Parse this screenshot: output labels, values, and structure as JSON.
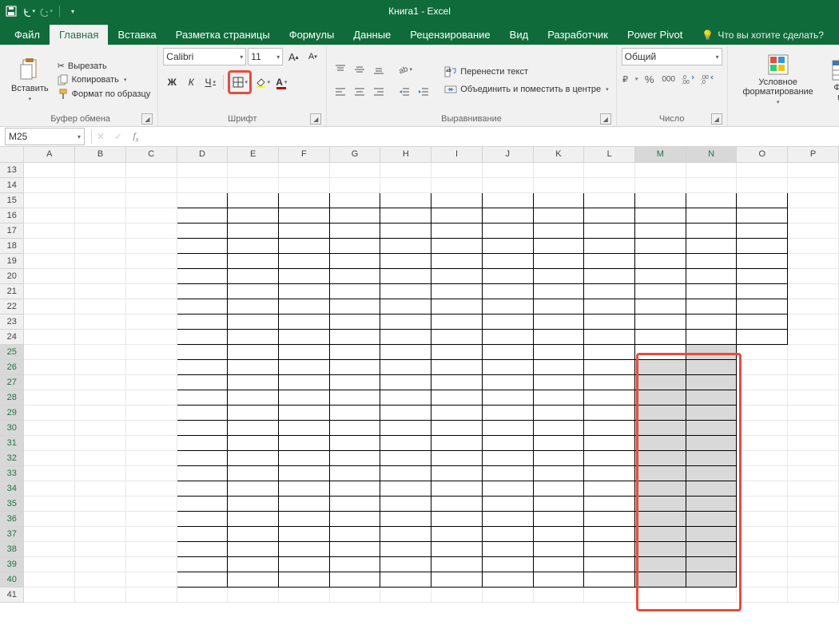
{
  "app": {
    "title": "Книга1 - Excel"
  },
  "qat": {
    "save": "save",
    "undo": "undo",
    "redo": "redo"
  },
  "tabs": {
    "items": [
      "Файл",
      "Главная",
      "Вставка",
      "Разметка страницы",
      "Формулы",
      "Данные",
      "Рецензирование",
      "Вид",
      "Разработчик",
      "Power Pivot"
    ],
    "active": 1,
    "tellme": "Что вы хотите сделать?"
  },
  "ribbon": {
    "clipboard": {
      "label": "Буфер обмена",
      "paste": "Вставить",
      "cut": "Вырезать",
      "copy": "Копировать",
      "format_painter": "Формат по образцу"
    },
    "font": {
      "label": "Шрифт",
      "name": "Calibri",
      "size": "11",
      "bold": "Ж",
      "italic": "К",
      "underline": "Ч"
    },
    "alignment": {
      "label": "Выравнивание",
      "wrap": "Перенести текст",
      "merge": "Объединить и поместить в центре"
    },
    "number": {
      "label": "Число",
      "format": "Общий"
    },
    "styles": {
      "conditional": "Условное форматирование",
      "format_as": "Фор\nка"
    }
  },
  "namebox": {
    "ref": "M25"
  },
  "columns": [
    "A",
    "B",
    "C",
    "D",
    "E",
    "F",
    "G",
    "H",
    "I",
    "J",
    "K",
    "L",
    "M",
    "N",
    "O",
    "P"
  ],
  "rows_start": 13,
  "rows_end": 41,
  "bordered_range": {
    "c1": 3,
    "c2": 13,
    "r1": 15,
    "r2": 40
  },
  "o_bordered": {
    "col": 14,
    "r1": 15,
    "r2": 24
  },
  "selection": {
    "c1": 12,
    "c2": 13,
    "r1": 25,
    "r2": 40,
    "active_r": 25,
    "active_c": 12
  }
}
